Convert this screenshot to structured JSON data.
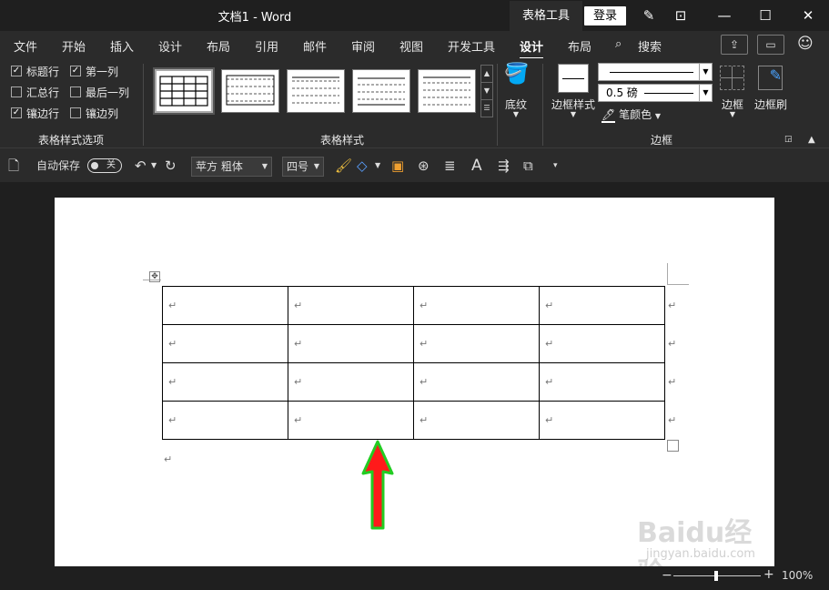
{
  "title_bar": {
    "doc_title": "文档1  -  Word",
    "context_tab": "表格工具",
    "login_label": "登录"
  },
  "menu": {
    "tabs": [
      "文件",
      "开始",
      "插入",
      "设计",
      "布局",
      "引用",
      "邮件",
      "审阅",
      "视图",
      "开发工具",
      "设计",
      "布局"
    ],
    "active_tab": "设计",
    "search_label": "搜索"
  },
  "ribbon": {
    "options": {
      "items": [
        {
          "label": "标题行",
          "checked": true
        },
        {
          "label": "第一列",
          "checked": true
        },
        {
          "label": "汇总行",
          "checked": false
        },
        {
          "label": "最后一列",
          "checked": false
        },
        {
          "label": "镶边行",
          "checked": true
        },
        {
          "label": "镶边列",
          "checked": false
        }
      ],
      "group_label": "表格样式选项"
    },
    "styles": {
      "group_label": "表格样式",
      "shading_label": "底纹"
    },
    "borders": {
      "border_styles_label": "边框样式",
      "weight_value": "0.5 磅",
      "pen_color_label": "笔颜色",
      "borders_label": "边框",
      "painter_label": "边框刷",
      "group_label": "边框"
    }
  },
  "qat": {
    "autosave_label": "自动保存",
    "autosave_state": "关",
    "font_name": "苹方 粗体",
    "font_size": "四号"
  },
  "document": {
    "rows": 4,
    "cols": 4,
    "cell_mark": "↵",
    "arrow_color": "#ff1a1a",
    "arrow_outline": "#22cc22"
  },
  "status": {
    "zoom": "100%"
  },
  "watermark": {
    "brand": "Baidu经验",
    "url": "jingyan.baidu.com"
  }
}
